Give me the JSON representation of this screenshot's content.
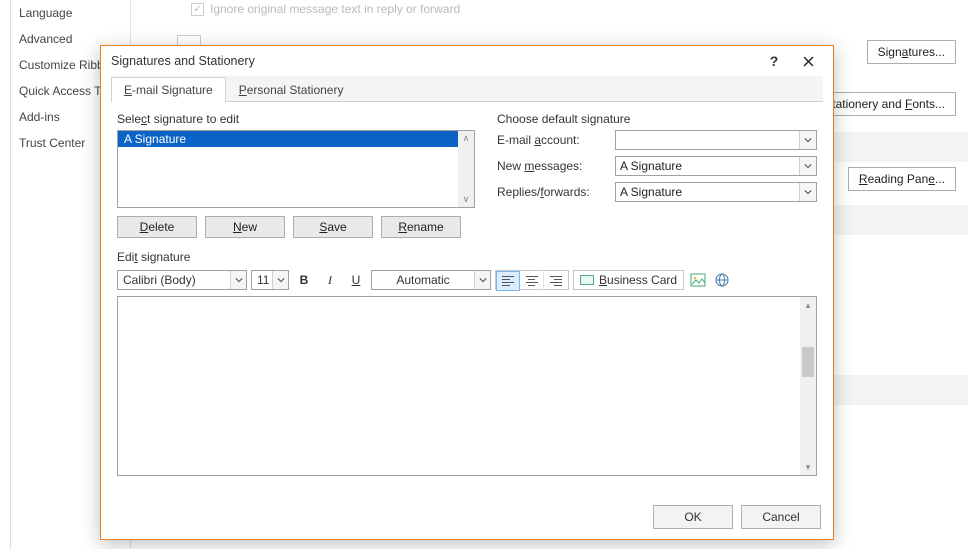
{
  "bg": {
    "nav": [
      "Language",
      "Advanced",
      "Customize Ribbon",
      "Quick Access Toolbar",
      "Add-ins",
      "Trust Center"
    ],
    "checkbox_label": "Ignore original message text in reply or forward",
    "buttons": {
      "signatures": "Signatures...",
      "stationery": "Stationery and Fonts...",
      "reading": "Reading Pane..."
    }
  },
  "dialog": {
    "title": "Signatures and Stationery",
    "tabs": {
      "email": "E-mail Signature",
      "personal": "Personal Stationery"
    },
    "select_label": "Select signature to edit",
    "signature_list": [
      "A Signature"
    ],
    "buttons": {
      "delete": "Delete",
      "new": "New",
      "save": "Save",
      "rename": "Rename"
    },
    "defaults": {
      "heading": "Choose default signature",
      "email_account_label": "E-mail account:",
      "email_account_value": "",
      "new_messages_label": "New messages:",
      "new_messages_value": "A Signature",
      "replies_label": "Replies/forwards:",
      "replies_value": "A Signature"
    },
    "edit_label": "Edit signature",
    "toolbar": {
      "font": "Calibri (Body)",
      "size": "11",
      "color": "Automatic",
      "business_card": "Business Card"
    },
    "footer": {
      "ok": "OK",
      "cancel": "Cancel"
    }
  }
}
